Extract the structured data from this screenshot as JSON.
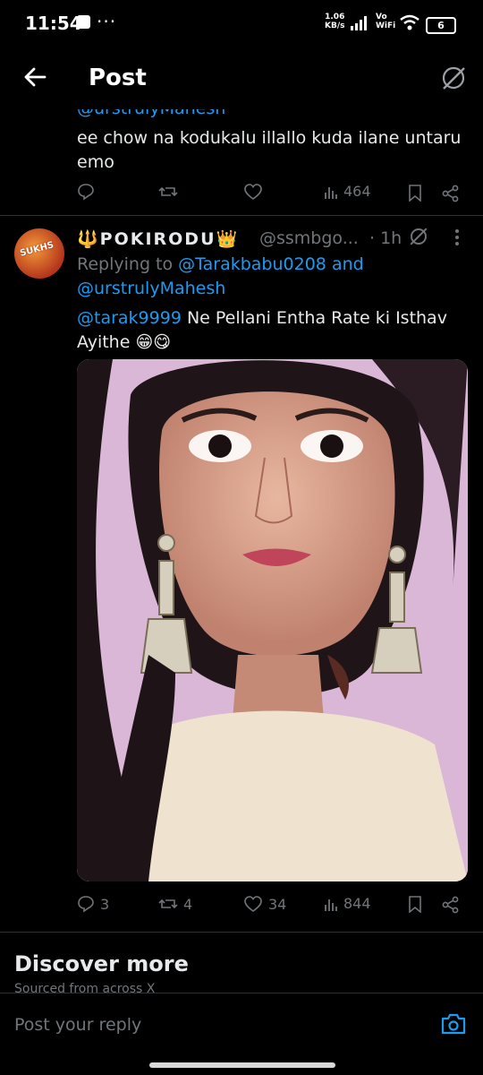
{
  "status_bar": {
    "time": "11:54",
    "network_speed": "1.06",
    "network_unit": "KB/s",
    "vowifi_top": "Vo",
    "vowifi_bottom": "WiFi",
    "battery": "6"
  },
  "header": {
    "title": "Post"
  },
  "first_post": {
    "partial_handle": "@urstrulyMahesh",
    "text": "ee chow na kodukalu illallo kuda ilane untaru emo",
    "views": "464"
  },
  "second_post": {
    "display_name": "🔱POKIRODU👑",
    "handle": "@ssmbgo...",
    "dot": "·",
    "time": "1h",
    "replying_prefix": "Replying to",
    "reply_target_1": "@Tarakbabu0208",
    "reply_and": "and",
    "reply_target_2": "@urstrulyMahesh",
    "mention": "@tarak9999",
    "text": " Ne Pellani Entha Rate ki Isthav Ayithe 😁😋",
    "replies": "3",
    "reposts": "4",
    "likes": "34",
    "views": "844",
    "avatar_text": "SUKHS"
  },
  "discover": {
    "title": "Discover more",
    "subtitle": "Sourced from across X"
  },
  "reply_bar": {
    "placeholder": "Post your reply"
  },
  "colors": {
    "accent": "#1d9bf0",
    "muted": "#71767b",
    "text": "#e7e9ea",
    "background": "#000000"
  }
}
